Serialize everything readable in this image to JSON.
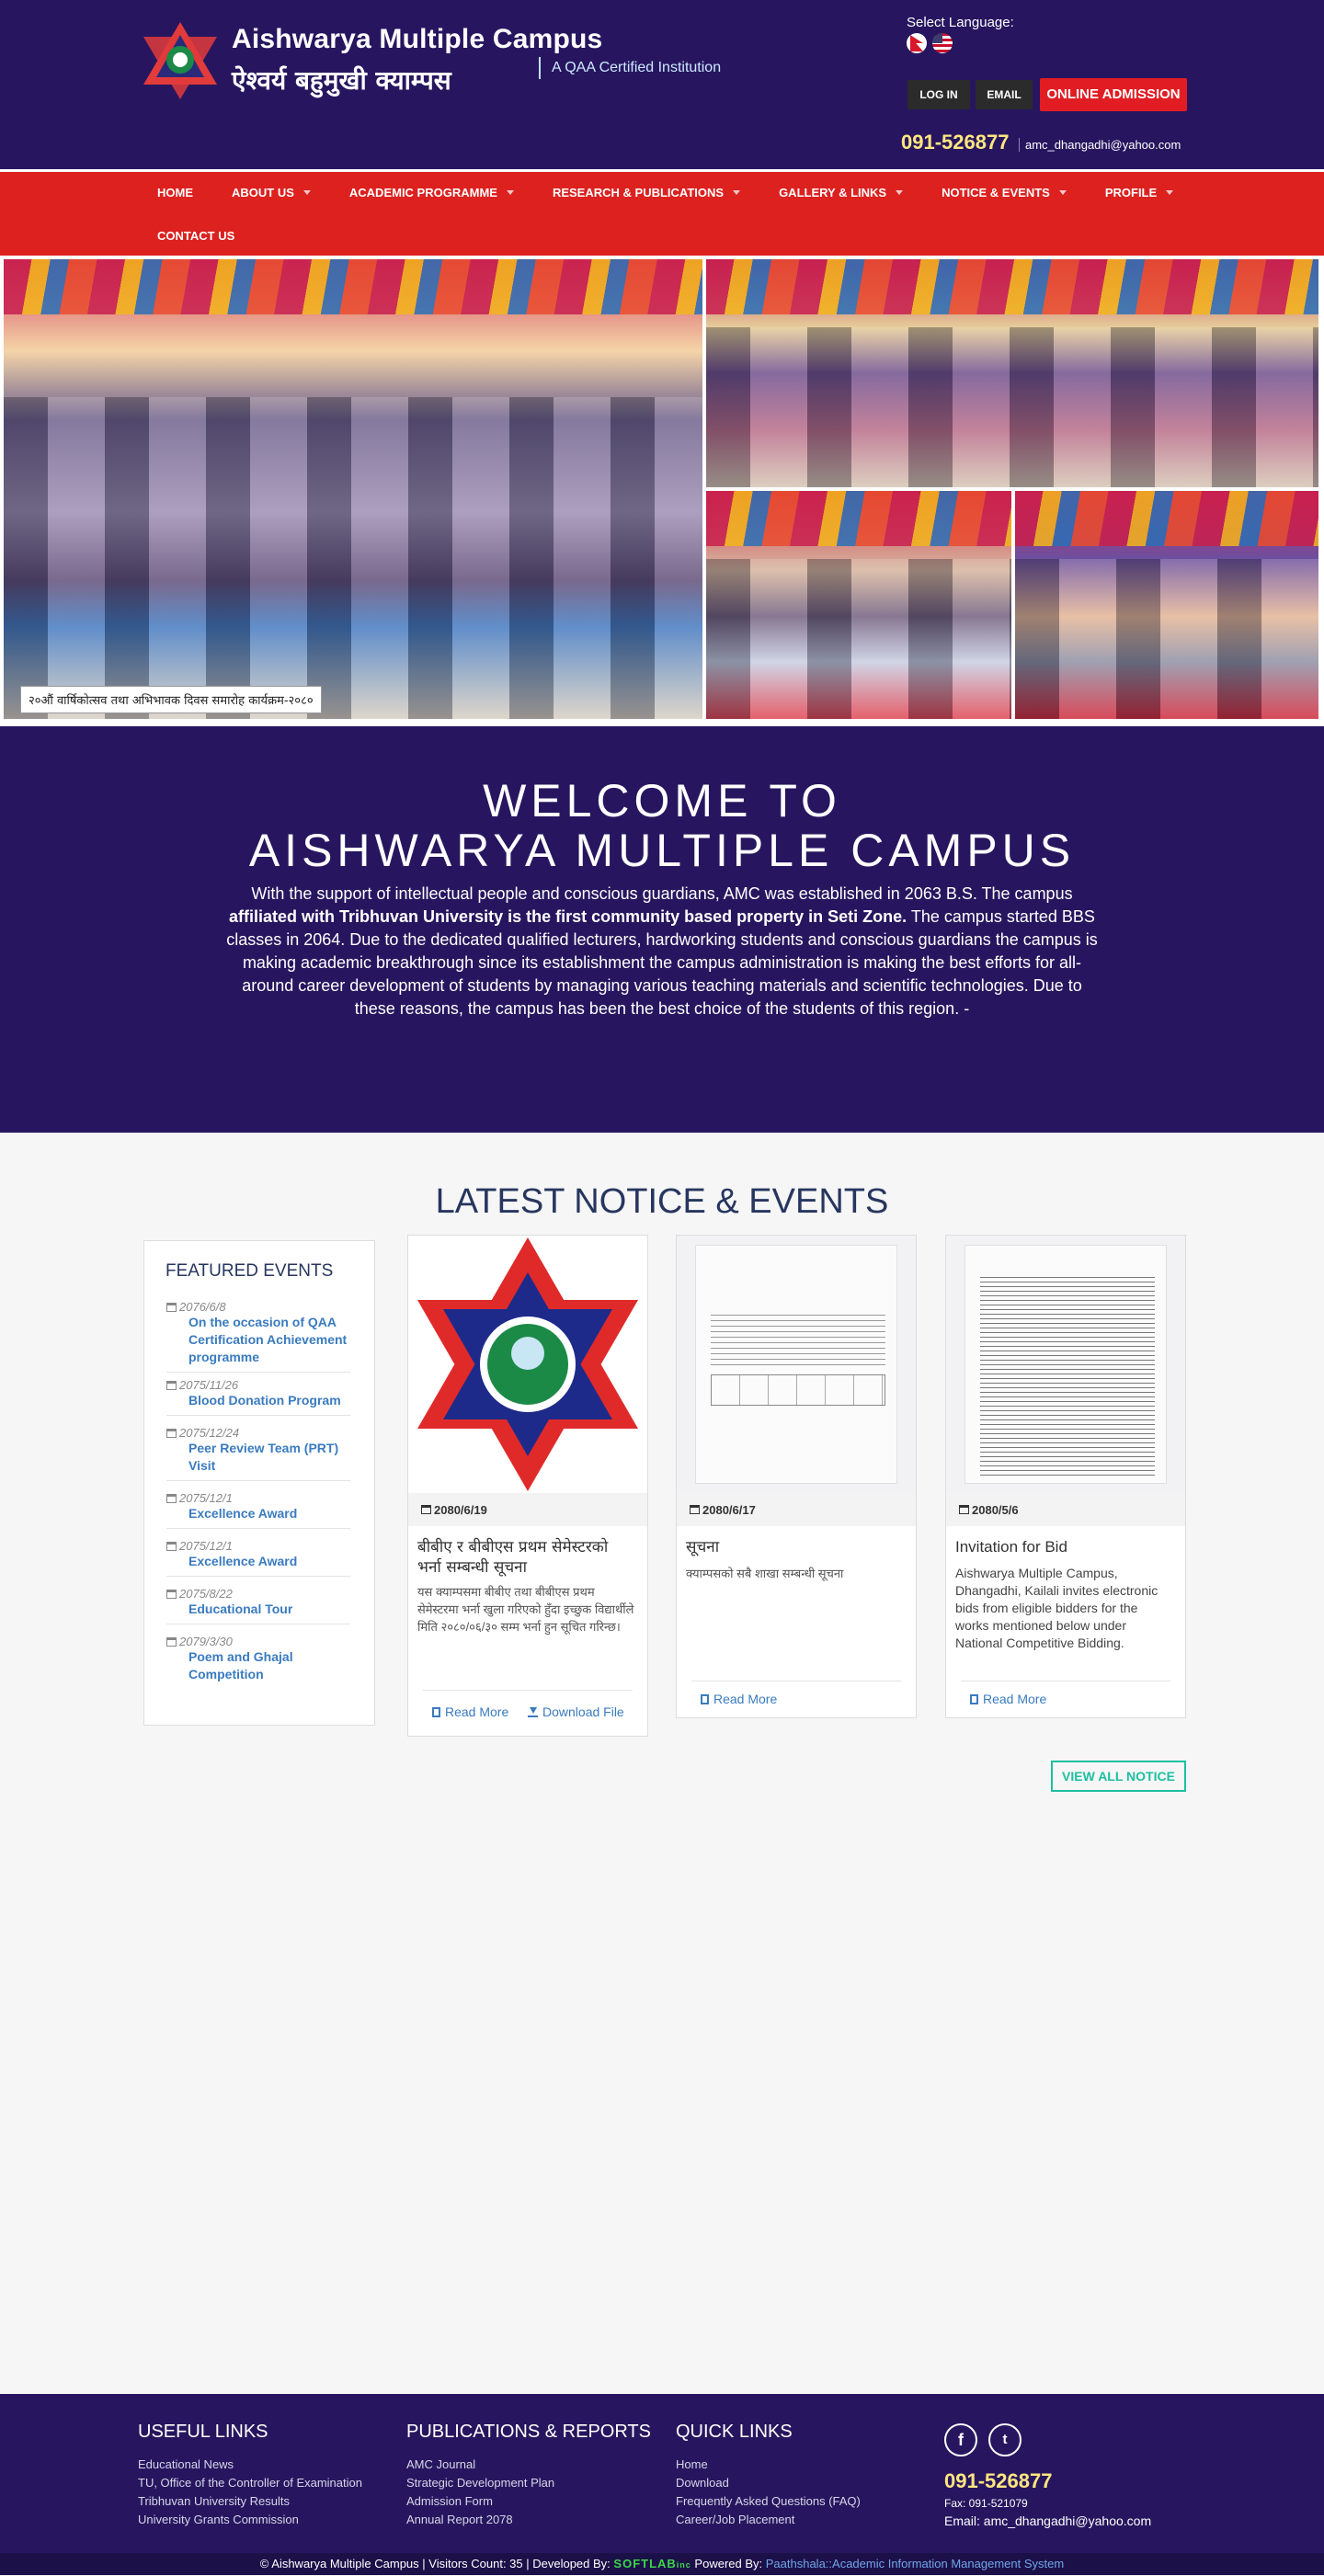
{
  "header": {
    "brand_en": "Aishwarya Multiple Campus",
    "brand_np": "ऐश्वर्य बहुमुखी क्याम्पस",
    "qaa": "A QAA Certified Institution",
    "select_language": "Select Language:",
    "login_label": "LOG IN",
    "email_label": "EMAIL",
    "admission_label": "ONLINE ADMISSION",
    "phone": "091-526877",
    "email": "amc_dhangadhi@yahoo.com"
  },
  "nav": {
    "items": [
      {
        "label": "HOME"
      },
      {
        "label": "ABOUT US"
      },
      {
        "label": "ACADEMIC PROGRAMME"
      },
      {
        "label": "RESEARCH & PUBLICATIONS"
      },
      {
        "label": "GALLERY & LINKS"
      },
      {
        "label": "NOTICE & EVENTS"
      },
      {
        "label": "PROFILE"
      },
      {
        "label": "CONTACT US"
      }
    ]
  },
  "gallery": {
    "caption": "२०औं वार्षिकोत्सव तथा अभिभावक दिवस समारोह कार्यक्रम-२०८०"
  },
  "welcome": {
    "title_line1": "WELCOME TO",
    "title_line2": "AISHWARYA MULTIPLE CAMPUS",
    "intro_a": "With the support of intellectual people and conscious guardians, AMC was established in 2063 B.S. The campus ",
    "intro_bold": "affiliated with Tribhuvan University is the first community based property in Seti Zone.",
    "intro_b": " The campus started BBS classes in 2064. Due to the dedicated qualified lecturers, hardworking students and conscious guardians the campus is making academic breakthrough since its establishment the campus administration is making the best efforts for all-around career development of students by managing various teaching materials and scientific technologies. Due to these reasons, the campus has been the best choice of the students of this region. -"
  },
  "notices": {
    "section_title": "LATEST NOTICE & EVENTS",
    "featured_title": "FEATURED EVENTS",
    "featured": [
      {
        "date": "2076/6/8",
        "title": "On the occasion of QAA Certification Achievement programme"
      },
      {
        "date": "2075/11/26",
        "title": "Blood Donation Program"
      },
      {
        "date": "2075/12/24",
        "title": "Peer Review Team (PRT) Visit"
      },
      {
        "date": "2075/12/1",
        "title": "Excellence Award"
      },
      {
        "date": "2075/12/1",
        "title": "Excellence Award"
      },
      {
        "date": "2075/8/22",
        "title": "Educational Tour"
      },
      {
        "date": "2079/3/30",
        "title": "Poem and Ghajal Competition"
      }
    ],
    "cards": [
      {
        "date": "2080/6/19",
        "title": "बीबीए र बीबीएस प्रथम सेमेस्टरको भर्ना सम्बन्धी सूचना",
        "desc": "यस क्याम्पसमा बीबीए तथा बीबीएस प्रथम सेमेस्टरमा भर्ना खुला गरिएको हुँदा इच्छुक विद्यार्थीले मिति २०८०/०६/३० सम्म भर्ना हुन सूचित गरिन्छ।",
        "read_more": "Read More",
        "download": "Download File"
      },
      {
        "date": "2080/6/17",
        "title": "सूचना",
        "desc": "क्याम्पसको सबै शाखा सम्बन्धी सूचना",
        "read_more": "Read More"
      },
      {
        "date": "2080/5/6",
        "title": "Invitation for Bid",
        "desc": "Aishwarya Multiple Campus, Dhangadhi, Kailali invites electronic bids from eligible bidders for the works mentioned below under National Competitive Bidding.",
        "read_more": "Read More"
      }
    ],
    "view_all": "VIEW ALL NOTICE"
  },
  "footer": {
    "useful_title": "USEFUL LINKS",
    "useful": [
      "Educational News",
      "TU, Office of the Controller of Examination",
      "Tribhuvan University Results",
      "University Grants Commission"
    ],
    "pubs_title": "PUBLICATIONS & REPORTS",
    "pubs": [
      "AMC Journal",
      "Strategic Development Plan",
      "Admission Form",
      "Annual Report 2078"
    ],
    "quick_title": "QUICK LINKS",
    "quick": [
      "Home",
      "Download",
      "Frequently Asked Questions (FAQ)",
      "Career/Job Placement"
    ],
    "phone": "091-526877",
    "fax": "Fax: 091-521079",
    "email": "Email: amc_dhangadhi@yahoo.com",
    "copyright_a": "© Aishwarya Multiple Campus | Visitors Count: 35 | Developed By: ",
    "softlab": "SOFTLAB",
    "softlab_suffix": "inc",
    "powered": " Powered By: ",
    "aims": "Paathshala::Academic Information Management System"
  },
  "colors": {
    "header_bg": "#27165f",
    "nav_bg": "#dc211f",
    "admission_btn": "#e11d23",
    "phone_yellow": "#ffe680",
    "link_blue": "#3a7bbf",
    "teal": "#1dbfa0"
  }
}
